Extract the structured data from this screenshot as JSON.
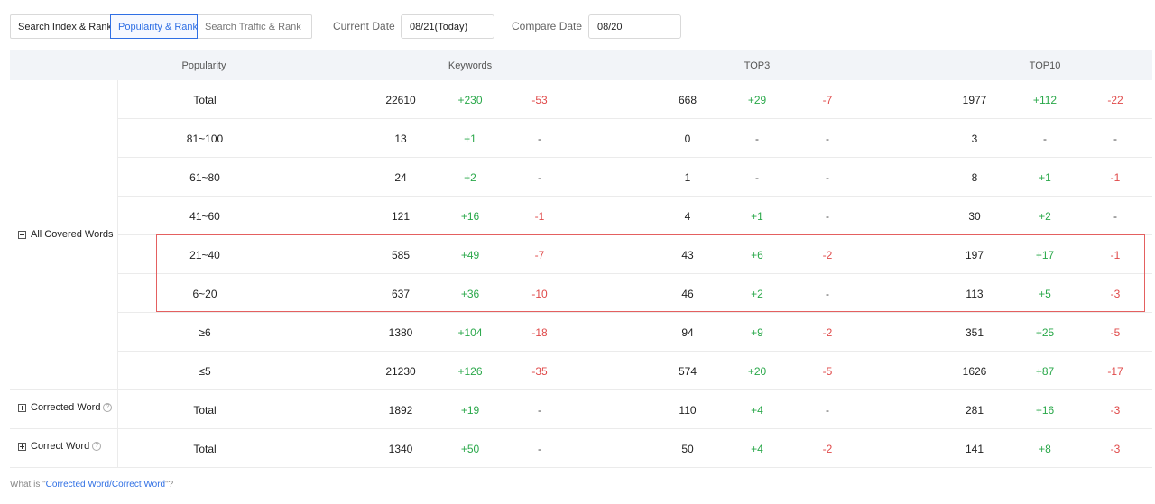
{
  "tabs": {
    "search_index": "Search Index & Rank",
    "popularity": "Popularity & Rank",
    "search_traffic": "Search Traffic & Rank"
  },
  "filters": {
    "current_date_label": "Current Date",
    "current_date_value": "08/21(Today)",
    "compare_date_label": "Compare Date",
    "compare_date_value": "08/20"
  },
  "table": {
    "headers": [
      "Popularity",
      "Keywords",
      "TOP3",
      "TOP10"
    ],
    "groups": {
      "all_covered": "All Covered Words",
      "corrected": "Corrected Word",
      "correct": "Correct Word"
    },
    "rows": [
      {
        "label": "Total",
        "kw": [
          "22610",
          "+230",
          "-53"
        ],
        "top3": [
          "668",
          "+29",
          "-7"
        ],
        "top10": [
          "1977",
          "+112",
          "-22"
        ]
      },
      {
        "label": "81~100",
        "kw": [
          "13",
          "+1",
          "-"
        ],
        "top3": [
          "0",
          "-",
          "-"
        ],
        "top10": [
          "3",
          "-",
          "-"
        ]
      },
      {
        "label": "61~80",
        "kw": [
          "24",
          "+2",
          "-"
        ],
        "top3": [
          "1",
          "-",
          "-"
        ],
        "top10": [
          "8",
          "+1",
          "-1"
        ]
      },
      {
        "label": "41~60",
        "kw": [
          "121",
          "+16",
          "-1"
        ],
        "top3": [
          "4",
          "+1",
          "-"
        ],
        "top10": [
          "30",
          "+2",
          "-"
        ]
      },
      {
        "label": "21~40",
        "kw": [
          "585",
          "+49",
          "-7"
        ],
        "top3": [
          "43",
          "+6",
          "-2"
        ],
        "top10": [
          "197",
          "+17",
          "-1"
        ]
      },
      {
        "label": "6~20",
        "kw": [
          "637",
          "+36",
          "-10"
        ],
        "top3": [
          "46",
          "+2",
          "-"
        ],
        "top10": [
          "113",
          "+5",
          "-3"
        ]
      },
      {
        "label": "≥6",
        "kw": [
          "1380",
          "+104",
          "-18"
        ],
        "top3": [
          "94",
          "+9",
          "-2"
        ],
        "top10": [
          "351",
          "+25",
          "-5"
        ]
      },
      {
        "label": "≤5",
        "kw": [
          "21230",
          "+126",
          "-35"
        ],
        "top3": [
          "574",
          "+20",
          "-5"
        ],
        "top10": [
          "1626",
          "+87",
          "-17"
        ]
      },
      {
        "label": "Total",
        "kw": [
          "1892",
          "+19",
          "-"
        ],
        "top3": [
          "110",
          "+4",
          "-"
        ],
        "top10": [
          "281",
          "+16",
          "-3"
        ]
      },
      {
        "label": "Total",
        "kw": [
          "1340",
          "+50",
          "-"
        ],
        "top3": [
          "50",
          "+4",
          "-2"
        ],
        "top10": [
          "141",
          "+8",
          "-3"
        ]
      }
    ]
  },
  "footer": {
    "prefix": "What is \"",
    "link": "Corrected Word/Correct Word",
    "suffix": "\"?"
  },
  "colors": {
    "accent": "#2f6fe4",
    "positive": "#2aa84a",
    "negative": "#e04a4a",
    "highlight_border": "#e46060",
    "header_bg": "#f2f4f8"
  }
}
